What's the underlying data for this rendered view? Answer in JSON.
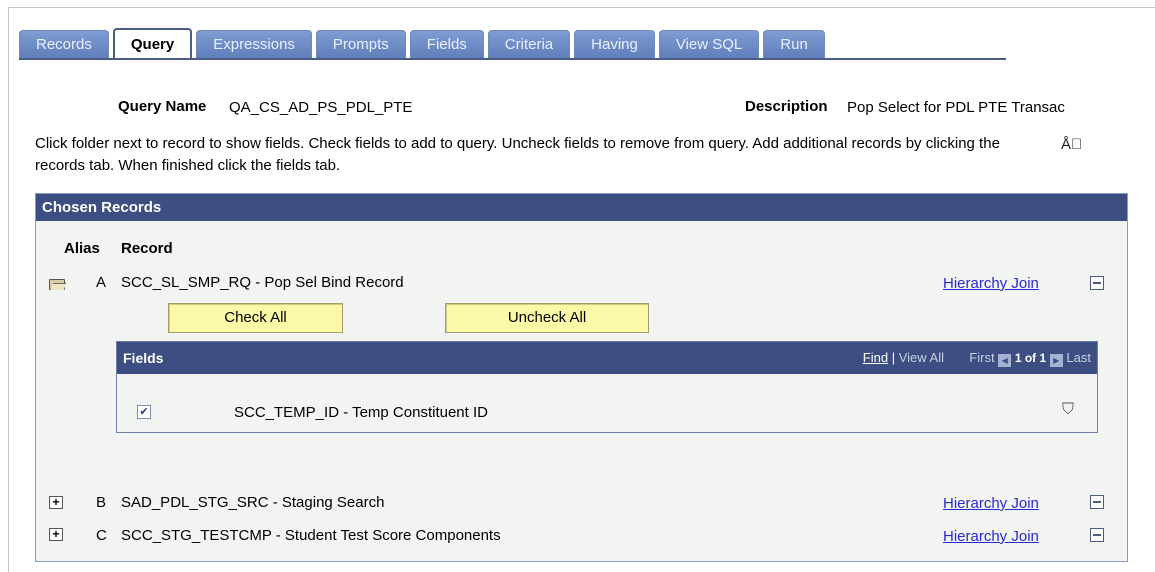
{
  "tabs": [
    "Records",
    "Query",
    "Expressions",
    "Prompts",
    "Fields",
    "Criteria",
    "Having",
    "View SQL",
    "Run"
  ],
  "active_tab": "Query",
  "query": {
    "name_label": "Query Name",
    "name_value": "QA_CS_AD_PS_PDL_PTE",
    "description_label": "Description",
    "description_value": "Pop Select for PDL PTE Transac"
  },
  "instructions": "Click folder next to record to show fields. Check fields to add to query. Uncheck fields to remove from query. Add additional records by clicking the records tab. When finished click the fields tab.",
  "chosen_records": {
    "title": "Chosen Records",
    "col_alias": "Alias",
    "col_record": "Record",
    "check_all": "Check All",
    "uncheck_all": "Uncheck All",
    "records": [
      {
        "alias": "A",
        "name": "SCC_SL_SMP_RQ - Pop Sel Bind Record",
        "link": "Hierarchy Join",
        "expanded": true
      },
      {
        "alias": "B",
        "name": "SAD_PDL_STG_SRC - Staging Search",
        "link": "Hierarchy Join",
        "expanded": false
      },
      {
        "alias": "C",
        "name": "SCC_STG_TESTCMP - Student Test Score Components",
        "link": "Hierarchy Join",
        "expanded": false
      }
    ]
  },
  "fields_grid": {
    "title": "Fields",
    "find": "Find",
    "view_all": "View All",
    "first": "First",
    "range": "1 of 1",
    "last": "Last",
    "rows": [
      {
        "name": "SCC_TEMP_ID - Temp Constituent ID",
        "checked": true
      }
    ]
  },
  "icons": {
    "spellcheck": "spellcheck-icon",
    "folder_open": "folder-open-icon",
    "folder_closed": "folder-plus-icon",
    "collapse": "minus-icon",
    "criteria": "funnel-plus-icon"
  }
}
